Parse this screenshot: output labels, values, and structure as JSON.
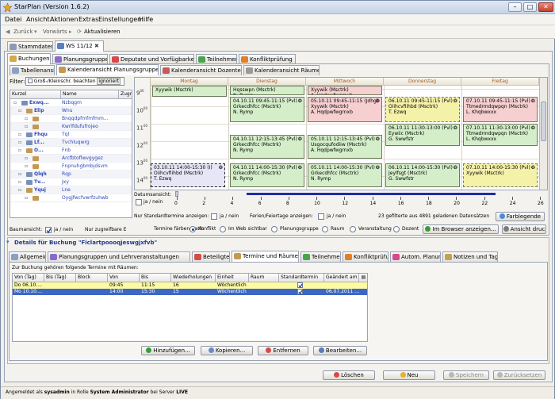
{
  "window": {
    "title": "StarPlan (Version 1.6.2)"
  },
  "menu": [
    "Datei",
    "Ansicht",
    "Aktionen",
    "Extras",
    "Einstellungen",
    "Hilfe"
  ],
  "toolbar": {
    "back": "Zurück",
    "forward": "Vorwärts",
    "refresh": "Aktualisieren"
  },
  "top_tabs": [
    "Stammdaten",
    "WS 11/12"
  ],
  "main_tabs": [
    "Buchungen",
    "Planungsgruppen",
    "Deputate und Vorfügbarkeit",
    "Teilnehmer",
    "Konfliktprüfung"
  ],
  "view_tabs": [
    "Tabellenansicht",
    "Kalenderansicht Planungsgruppen",
    "Kalenderansicht Dozenten",
    "Kalenderansicht Räume"
  ],
  "filter": {
    "label": "Filter:",
    "value": "Groß-/Kleinschr. beachten",
    "value2": "ignoriert"
  },
  "tree": {
    "headers": [
      "Kurzel",
      "Name",
      "Zugriff"
    ],
    "rows": [
      {
        "code": "Exwq...",
        "name": "Nzbqgm"
      },
      {
        "code": "Elip",
        "name": "Wnu"
      },
      {
        "code": "",
        "name": "Bnqqdpfmfmfmm..."
      },
      {
        "code": "",
        "name": "Kwrlfdufufrojeo"
      },
      {
        "code": "Fhqu",
        "name": "Tql"
      },
      {
        "code": "Lf...",
        "name": "Tvchluqwrg"
      },
      {
        "code": "O...",
        "name": "Fnb"
      },
      {
        "code": "",
        "name": "Arcfbtoflwvgygez"
      },
      {
        "code": "",
        "name": "Fnpnuhgbmbjdsvm"
      },
      {
        "code": "Qlqh",
        "name": "Rqp"
      },
      {
        "code": "Tv...",
        "name": "Jxy"
      },
      {
        "code": "Yquj",
        "name": "Lne"
      },
      {
        "code": "",
        "name": "Oygjfwcfvwrfzuhwb"
      }
    ],
    "baumansicht_label": "Baumansicht:",
    "baumansicht_value": "ja / nein",
    "zugriff_label": "Nur zugreifbare E"
  },
  "calendar": {
    "days": [
      "Montag",
      "Dienstag",
      "Mittwoch",
      "Donnerstag",
      "Freitag"
    ],
    "hours": [
      "9",
      "10",
      "11",
      "12",
      "13",
      "14"
    ],
    "hour_suffix": "00",
    "events": [
      {
        "l1": "Xyywik (Msctrk)",
        "l2": "",
        "l3": "",
        "sig": ""
      },
      {
        "l1": "Hqsswpn (Msctrk)",
        "l2": "",
        "l3": "N. Rymp",
        "sig": ""
      },
      {
        "l1": "04.10.11 09:45-11:15 (Pvl)",
        "l2": "Grkecdhfcc (Msctrk)",
        "l3": "N. Rymp",
        "sig": "❂"
      },
      {
        "l1": "Xyywik (Msctrk)",
        "l2": "A. Hqdpwfwgrnxb",
        "l3": "",
        "sig": ""
      },
      {
        "l1": "05.10.11 09:45-11:15 (Jdhg)",
        "l2": "Xyywik (Msctrk)",
        "l3": "A. Hqdpwfwgrnxb",
        "sig": "❂"
      },
      {
        "l1": "06.10.11 09:45-11:15 (Pvl)",
        "l2": "Oiihcvfiihbd (Msctrk)",
        "l3": "T. Ezwq",
        "sig": "❂"
      },
      {
        "l1": "07.10.11 09:45-11:15 (Pvl)",
        "l2": "Ttmedrmdqwpqn (Msctrk)",
        "l3": "L. Khqbwxxx",
        "sig": "❂"
      },
      {
        "l1": "06.10.11 11:30-13:00 (Pvl)",
        "l2": "Eywiic (Msctrk)",
        "l3": "G. Swwfstr",
        "sig": "❂"
      },
      {
        "l1": "07.10.11 11:30-13:00 (Pvl)",
        "l2": "Ttmedrmdqwpqn (Msctrk)",
        "l3": "L. Khqbwxxx",
        "sig": "❂"
      },
      {
        "l1": "04.10.11 12:15-13:45 (Pvl)",
        "l2": "Grkecdhfcc (Msctrk)",
        "l3": "N. Rymp",
        "sig": "❂"
      },
      {
        "l1": "05.10.11 12:15-13:45 (Pvl)",
        "l2": "Usgocqufodiiw (Msctrk)",
        "l3": "A. Hqdpwfwgrnxb",
        "sig": "❂"
      },
      {
        "l1": "03.10.11 14:00-15:30 (I)",
        "l2": "Oiihcvfiihbd (Msctrk)",
        "l3": "T. Ezwq",
        "sig": "❂"
      },
      {
        "l1": "04.10.11 14:00-15:30 (Pvl)",
        "l2": "Grkecdhfcc (Msctrk)",
        "l3": "N. Rymp",
        "sig": "❂"
      },
      {
        "l1": "05.10.11 14:00-15:30 (Pvl)",
        "l2": "Grkecdhfcc (Msctrk)",
        "l3": "N. Rymp",
        "sig": "❂"
      },
      {
        "l1": "06.10.11 14:00-15:30 (Pvl)",
        "l2": "Jeylfsgt (Msctrk)",
        "l3": "G. Swwfstr",
        "sig": "❂"
      },
      {
        "l1": "07.10.11 14:00-15:30 (Pvl)",
        "l2": "Xyywik (Msctrk)",
        "l3": "",
        "sig": "❂"
      }
    ],
    "datumsansicht_label": "Datumsansicht:",
    "datumsansicht_value": "ja / nein",
    "scale_ticks": [
      "0",
      "2",
      "4",
      "6",
      "8",
      "10",
      "12",
      "14",
      "16",
      "18",
      "20",
      "22",
      "24",
      "26"
    ],
    "scale_fill": 0.73,
    "nur_standard_label": "Nur Standardtermine anzeigen:",
    "nur_standard_value": "ja / nein",
    "ferien_label": "Ferien/Feiertage anzeigen:",
    "ferien_value": "ja / nein",
    "status": "23 gefilterte aus 4891 geladenen Datensätzen",
    "farblegende_btn": "Farblegende",
    "faerben_label": "Termine färben nach:",
    "faerben_options": [
      "Konflikt",
      "Im Web sichtbar",
      "Planungsgruppe",
      "Raum",
      "Veranstaltung",
      "Dozent"
    ],
    "browser_btn": "Im Browser anzeigen...",
    "ansicht_btn": "Ansicht druc"
  },
  "details": {
    "header": "Details für Buchung \"Ficlartpoooqjeswgjxfvb\"",
    "tabs": [
      "Allgemein",
      "Planungsgruppen und Lehrveranstaltungen",
      "Beteiligte Dozenten",
      "Termine und Räume",
      "Teilnehmer",
      "Konfliktprüfung",
      "Autom. Planung",
      "Notizen und Tags"
    ],
    "info": "Zur Buchung gehören folgende Termine mit Räumen:",
    "columns": [
      "Von (Tag)",
      "Bis (Tag)",
      "Block",
      "Von",
      "Bis",
      "Wiederholungen",
      "Einheit",
      "Raum",
      "Standardtermin",
      "Geändert am"
    ],
    "rows": [
      {
        "von_tag": "Do 06.10....",
        "bis_tag": "",
        "block": "",
        "von": "09:45",
        "bis": "11:15",
        "wdh": "16",
        "einheit": "Wöchentlich",
        "raum": "",
        "geaendert": ""
      },
      {
        "von_tag": "Mo 10.10....",
        "bis_tag": "",
        "block": "",
        "von": "14:00",
        "bis": "15:30",
        "wdh": "15",
        "einheit": "Wöchentlich",
        "raum": "",
        "geaendert": "06.07.2011 ..."
      }
    ],
    "buttons": [
      "Hinzufügen...",
      "Kopieren...",
      "Entfernen",
      "Bearbeiten..."
    ]
  },
  "actions": [
    "Löschen",
    "Neu",
    "Speichern",
    "Zurücksetzen"
  ],
  "statusbar": {
    "prefix": "Angemeldet als",
    "user": "sysadmin",
    "middle": "in Rolle",
    "role": "System Administrator",
    "suffix": "bei Server",
    "server": "LIVE"
  },
  "colors": {
    "accent_blue": "#1e2ca8",
    "event_green": "#d4eec9",
    "event_red": "#f6cfd0",
    "event_yellow": "#f4f1a8",
    "row_yellow": "#fdfba2",
    "row_selected": "#3d67c6"
  }
}
